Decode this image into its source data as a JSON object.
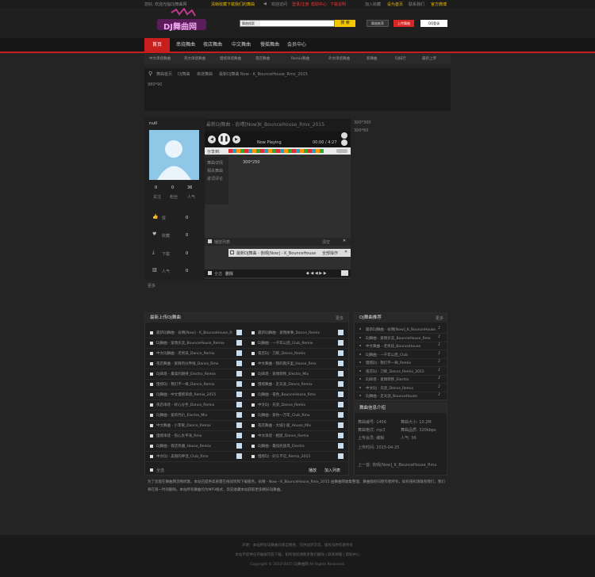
{
  "top": {
    "welcome": "您好, 欢迎光临DJ舞曲网",
    "tip": "清晰收藏下载我们的舞曲",
    "links": [
      "登录/注册",
      "帮助中心",
      "下载说明",
      "会员中心"
    ],
    "right": [
      "加入收藏",
      "设为首页",
      "联系我们",
      "网站导航",
      "官方微博"
    ]
  },
  "logo": "DJ舞曲网",
  "search": {
    "select": "舞曲搜索",
    "button": "搜 索",
    "placeholder": ""
  },
  "buttons": {
    "recommend": "舞曲推荐",
    "upload": "上传舞曲",
    "qq": "QQ登录"
  },
  "nav": [
    "首页",
    "串烧舞曲",
    "夜店舞曲",
    "中文舞曲",
    "慢摇舞曲",
    "英文舞曲",
    "会员中心"
  ],
  "subnav": [
    "中文串烧舞曲",
    "英文串烧舞曲",
    "慢摇串烧舞曲",
    "夜店舞曲",
    "Remix舞曲",
    "外文串烧舞曲",
    "新舞曲",
    "DJ排行",
    "最新上传"
  ],
  "breadcrumb": [
    "舞曲首页",
    "DJ舞曲",
    "串烧舞曲",
    "最新DJ舞曲 Now - K_BounceHouse_Rmx_2015"
  ],
  "ad": "980*90",
  "user": {
    "name": "null",
    "stats": [
      {
        "n": "0",
        "l": "关注"
      },
      {
        "n": "0",
        "l": "粉丝"
      },
      {
        "n": "36",
        "l": "人气"
      }
    ],
    "actions": [
      {
        "icon": "thumbs-up-icon",
        "label": "赞",
        "val": "0"
      },
      {
        "icon": "heart-icon",
        "label": "收藏",
        "val": "0"
      },
      {
        "icon": "download-icon",
        "label": "下载",
        "val": "0"
      },
      {
        "icon": "chart-icon",
        "label": "人气",
        "val": "0"
      }
    ],
    "more": "更多"
  },
  "song": {
    "title": "最新DJ舞曲 - 俞晴[Now]K_BounceHouse_Rmx_2015",
    "status": "Now Playing",
    "time": "00:00 / 4:27",
    "player_ad": "300*250",
    "tabs": [
      "舞曲详情",
      "相关舞曲",
      "歌词评论"
    ],
    "playlist_label": "播放列表",
    "clear": "清空",
    "playlist_item": "最新DJ舞曲 - 俞晴[Now] - K_BounceHouse_Rmx_2015",
    "playlist_op": "全部操作",
    "footer": [
      "全选",
      "删除"
    ]
  },
  "right_ads": [
    "300*300",
    "300*60"
  ],
  "left_panel": {
    "title": "最新上传DJ舞曲",
    "more": "更多",
    "col1": [
      "最新DJ舞曲 - 俞晴[Now] - K_BounceHouse_Rmx",
      "DJ舞曲 - 爱情买卖_BounceHouse_Remix",
      "中文DJ舞曲 - 老男孩_Dance_Remix",
      "夜店舞曲 - 爱情的分界线_Dance_Rmx",
      "DJ串烧 - 最美的期待_Electro_Remix",
      "慢摇DJ - 我们不一样_Dance_Remix",
      "DJ舞曲 - 中文慢摇串烧_Remix_2015",
      "夜店串烧 - 好心分手_Dance_Remix",
      "DJ舞曲 - 爱的代价_Electro_Mix",
      "中文舞曲 - 小苹果_Dance_Remix",
      "慢摇串烧 - 伤心太平洋_Rmx",
      "DJ舞曲 - 夜店热播_House_Remix",
      "中文DJ - 美丽的神话_Club_Rmx"
    ],
    "col2": [
      "最新DJ舞曲 - 爱情故事_Dance_Remix",
      "DJ舞曲 - 一千年以后_Club_Remix",
      "夜店DJ - 刀郎_Dance_Remix",
      "中文舞曲 - 我的歌声里_House_Rmx",
      "DJ串烧 - 爱情转移_Electro_Mix",
      "慢摇舞曲 - 走天涯_Dance_Remix",
      "DJ舞曲 - 夜色_BounceHouse_Rmx",
      "中文DJ - 兄弟_Dance_Remix",
      "DJ舞曲 - 爱你一万年_Club_Rmx",
      "夜店舞曲 - 大城小爱_House_Mix",
      "中文串烧 - 相思_Dance_Remix",
      "DJ舞曲 - 最炫民族风_Electro",
      "慢摇DJ - 好久不见_Remix_2015"
    ],
    "all": "全选",
    "play": "播放",
    "add": "加入列表"
  },
  "right_list": {
    "title": "DJ舞曲推荐",
    "more": "更多",
    "items": [
      "最新DJ舞曲 - 俞晴[Now]_K_BounceHouse",
      "DJ舞曲 - 爱情买卖_BounceHouse_Rmx",
      "中文舞曲 - 老男孩_BounceHouse",
      "DJ舞曲 - 一千年以后_Club",
      "慢摇DJ - 我们不一样_Remix",
      "夜店DJ - 刀郎_Dance_Remix_2015",
      "DJ串烧 - 爱情转移_Electro",
      "中文DJ - 兄弟_Dance_Remix",
      "DJ舞曲 - 走天涯_BounceHouse"
    ]
  },
  "info": {
    "title": "舞曲信息介绍",
    "rows": [
      "舞曲编号: 1456",
      "舞曲格式: mp3",
      "舞曲大小: 10.2M",
      "舞曲品质: 320kbps",
      "上传会员: 编辑",
      "上传时间: 2015-04-25",
      "人气: 36"
    ],
    "extra": "上一首: 俞晴[Now]_K_BounceHouse_Rmx"
  },
  "desc": "为了您能在舞曲网流畅听歌，本站已提供高质量在线试听和下载服务。俞晴 - Now - K_BounceHouse_Rmx_2015 由舞曲网收集整理，舞曲版权归原作者所有，如有侵权请联系我们，我们将在第一时间删除。本站所有舞曲均为MP3格式，欢迎收藏本站获取更多精彩DJ舞曲。",
  "footer": [
    "声明：本站所有DJ舞曲均来自网络，仅供试听交流，版权归原作者所有",
    "本站不提供任何破解内容下载，如有侵权请联系我们删除 | 联系邮箱 | 帮助中心",
    "Copyright © 2010-2015 DJ舞曲网 All Rights Reserved."
  ]
}
